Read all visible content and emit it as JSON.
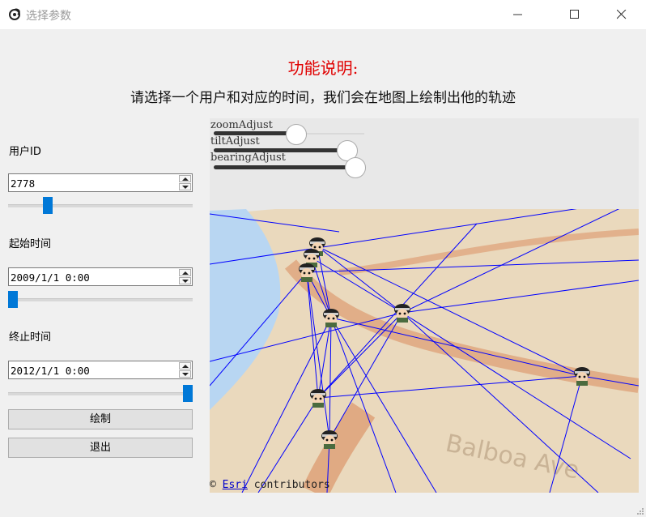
{
  "window": {
    "title": "选择参数",
    "app_icon": "leaf-swirl-icon",
    "controls": [
      "minimize-icon",
      "maximize-icon",
      "close-icon"
    ]
  },
  "header": {
    "heading": "功能说明:",
    "description": "请选择一个用户和对应的时间，我们会在地图上绘制出他的轨迹"
  },
  "form": {
    "user_label": "用户ID",
    "user_value": "2778",
    "user_slider_level": 0.2,
    "start_label": "起始时间",
    "start_value": "2009/1/1 0:00",
    "start_slider_level": 0.0,
    "end_label": "终止时间",
    "end_value": "2012/1/1 0:00",
    "end_slider_level": 1.0,
    "draw_button": "绘制",
    "exit_button": "退出"
  },
  "map": {
    "controls": [
      {
        "label": "zoomAdjust",
        "level": 0.5
      },
      {
        "label": "tiltAdjust",
        "level": 0.8
      },
      {
        "label": "bearingAdjust",
        "level": 0.85
      }
    ],
    "credit_prefix": "©",
    "credit_link": "Esri",
    "credit_suffix": "contributors",
    "background_label": "Balboa Ave",
    "colors": {
      "track": "#0000ff",
      "water": "#b8d6f2",
      "land": "#ead9bd",
      "road": "#d98a5c",
      "sky": "#e8e8e8"
    }
  },
  "accent": "#0078d7"
}
